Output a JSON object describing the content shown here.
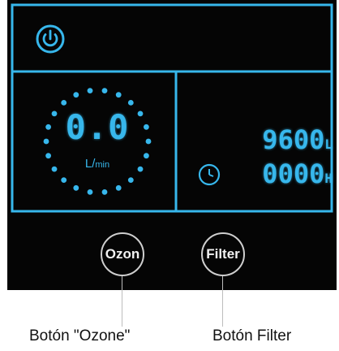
{
  "colors": {
    "panel_background": "#050505",
    "lcd_blue": "#37b7ec",
    "button_ring": "#cfcfcf",
    "callout_text": "#111111"
  },
  "display": {
    "power_icon": "power-icon",
    "flow": {
      "value": "0.0",
      "unit_prefix": "L/",
      "unit_suffix": "min"
    },
    "volume": {
      "value": "9600",
      "unit": "L"
    },
    "hours": {
      "icon": "clock-icon",
      "value": "0000",
      "unit": "H"
    }
  },
  "buttons": {
    "ozone_label": "Ozon",
    "filter_label": "Filter"
  },
  "callouts": {
    "ozone": "Botón \"Ozone\"",
    "filter": "Botón Filter"
  }
}
